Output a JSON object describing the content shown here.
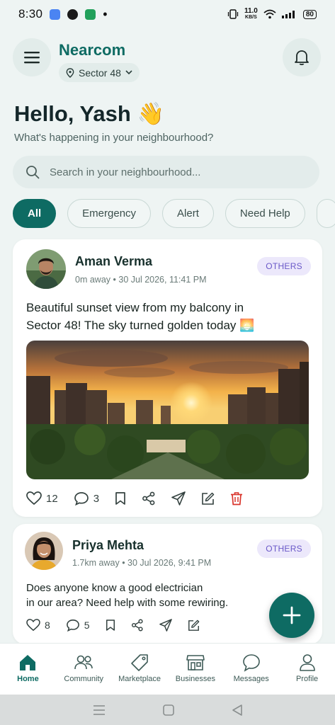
{
  "status": {
    "time": "8:30",
    "net_speed": "11.0",
    "net_unit": "KB/S",
    "battery": "80",
    "app_dot_colors": [
      "#4b84f2",
      "#1a1a1a",
      "#21a05a"
    ]
  },
  "header": {
    "app_name": "Nearcom",
    "location": "Sector 48"
  },
  "greeting": {
    "title": "Hello, Yash",
    "emoji": "👋",
    "subtitle": "What's happening in your neighbourhood?"
  },
  "search": {
    "placeholder": "Search in your neighbourhood..."
  },
  "filters": [
    {
      "label": "All",
      "active": true
    },
    {
      "label": "Emergency",
      "active": false
    },
    {
      "label": "Alert",
      "active": false
    },
    {
      "label": "Need Help",
      "active": false
    }
  ],
  "posts": [
    {
      "author": "Aman Verma",
      "distance": "0m away",
      "date": "30 Jul 2026, 11:41 PM",
      "tag": "OTHERS",
      "text_line1": "Beautiful sunset view from my balcony in",
      "text_line2": "Sector 48! The sky turned golden today 🌅",
      "likes": "12",
      "comments": "3"
    },
    {
      "author": "Priya Mehta",
      "distance": "1.7km away",
      "date": "30 Jul 2026, 9:41 PM",
      "tag": "OTHERS",
      "text_line1": "Does anyone know a good electrician",
      "text_line2": "in our area? Need help with some rewiring.",
      "likes": "8",
      "comments": "5"
    }
  ],
  "nav": [
    {
      "label": "Home",
      "icon": "home-icon",
      "active": true
    },
    {
      "label": "Community",
      "icon": "community-icon",
      "active": false
    },
    {
      "label": "Marketplace",
      "icon": "tag-icon",
      "active": false
    },
    {
      "label": "Businesses",
      "icon": "store-icon",
      "active": false
    },
    {
      "label": "Messages",
      "icon": "chat-icon",
      "active": false
    },
    {
      "label": "Profile",
      "icon": "profile-icon",
      "active": false
    }
  ],
  "colors": {
    "primary": "#0e6b63",
    "tag_bg": "#ece8fb",
    "tag_text": "#6a58c8",
    "delete": "#d9342b"
  }
}
